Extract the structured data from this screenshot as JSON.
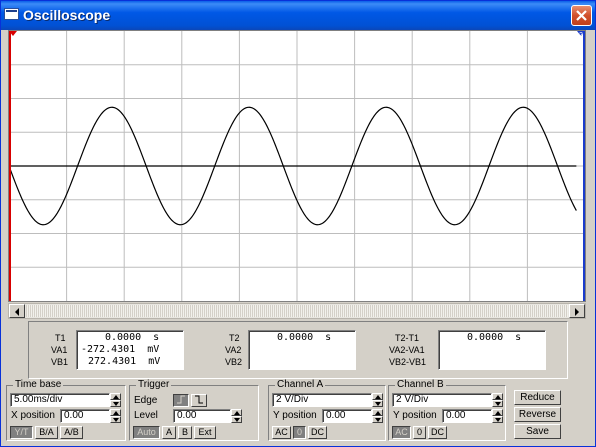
{
  "window": {
    "title": "Oscilloscope"
  },
  "colors": {
    "titlebar": "#0058e6",
    "trace": "#000000",
    "grid": "#bdbdbd",
    "marker_t1": "#d80000",
    "marker_t2": "#1a3ccc"
  },
  "markers": {
    "t1_label": "1",
    "t2_label": "2"
  },
  "readout": {
    "t1": {
      "label": "T1",
      "value": "0.0000  s"
    },
    "va1": {
      "label": "VA1",
      "value": "-272.4301  mV"
    },
    "vb1": {
      "label": "VB1",
      "value": "272.4301  mV"
    },
    "t2": {
      "label": "T2",
      "value": "0.0000  s"
    },
    "va2": {
      "label": "VA2"
    },
    "vb2": {
      "label": "VB2"
    },
    "t2t1": {
      "label": "T2-T1",
      "value": "0.0000  s"
    },
    "va2va1": {
      "label": "VA2-VA1"
    },
    "vb2vb1": {
      "label": "VB2-VB1"
    }
  },
  "timebase": {
    "title": "Time base",
    "scale": "5.00ms/div",
    "xpos_label": "X position",
    "xpos": "0.00",
    "modes": [
      "Y/T",
      "B/A",
      "A/B"
    ],
    "active_mode": "Y/T"
  },
  "trigger": {
    "title": "Trigger",
    "edge_label": "Edge",
    "level_label": "Level",
    "level": "0.00",
    "sources": [
      "Auto",
      "A",
      "B",
      "Ext"
    ],
    "active_source": "Auto"
  },
  "channel_a": {
    "title": "Channel A",
    "scale": "2  V/Div",
    "ypos_label": "Y position",
    "ypos": "0.00",
    "coupling": [
      "AC",
      "0",
      "DC"
    ],
    "active_coupling": "0"
  },
  "channel_b": {
    "title": "Channel B",
    "scale": "2  V/Div",
    "ypos_label": "Y position",
    "ypos": "0.00",
    "coupling": [
      "AC",
      "0",
      "DC"
    ],
    "active_coupling": "AC"
  },
  "actions": {
    "reduce": "Reduce",
    "reverse": "Reverse",
    "save": "Save"
  },
  "chart_data": {
    "type": "line",
    "grid": true,
    "grid_divisions": {
      "x": 10,
      "y": 8
    },
    "xlim_div": [
      0,
      10
    ],
    "ylim_div": [
      -4,
      4
    ],
    "series": [
      {
        "values_div": {
          "type": "sine",
          "amplitude": 1.74,
          "periods": 4.2,
          "phase_deg": 180,
          "end_div": 9.85
        },
        "color": "#000000"
      },
      {
        "values_div": {
          "type": "flat",
          "level": 0,
          "end_div": 9.85
        },
        "color": "#000000"
      }
    ]
  }
}
